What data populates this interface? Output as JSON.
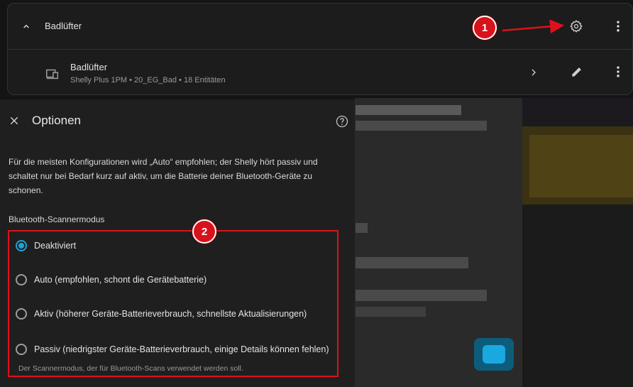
{
  "device_card": {
    "title": "Badlüfter",
    "device": {
      "name": "Badlüfter",
      "subtitle": "Shelly Plus 1PM • 20_EG_Bad • 18 Entitäten"
    }
  },
  "dialog": {
    "title": "Optionen",
    "description": "Für die meisten Konfigurationen wird „Auto“ empfohlen; der Shelly hört passiv und schaltet nur bei Bedarf kurz auf aktiv, um die Batterie deiner Bluetooth-Geräte zu schonen.",
    "group_label": "Bluetooth-Scannermodus",
    "options": [
      {
        "label": "Deaktiviert",
        "selected": true
      },
      {
        "label": "Auto (empfohlen, schont die Gerätebatterie)",
        "selected": false
      },
      {
        "label": "Aktiv (höherer Geräte-Batterieverbrauch, schnellste Aktualisierungen)",
        "selected": false
      },
      {
        "label": "Passiv (niedrigster Geräte-Batterieverbrauch, einige Details können fehlen)",
        "selected": false
      }
    ],
    "hint": "Der Scannermodus, der für Bluetooth-Scans verwendet werden soll."
  },
  "annotations": {
    "badge1": "1",
    "badge2": "2"
  },
  "colors": {
    "accent": "#1ea2d9",
    "annotation_red": "#e0101a"
  },
  "icons": [
    "chevron-up-icon",
    "gear-icon",
    "more-vert-icon",
    "device-icon",
    "chevron-right-icon",
    "pencil-icon",
    "close-icon",
    "help-circle-icon"
  ]
}
